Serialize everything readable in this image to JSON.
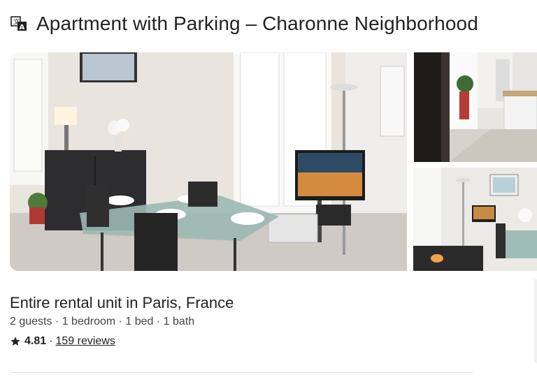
{
  "listing": {
    "title": "Apartment with Parking – Charonne Neighborhood",
    "subtitle": "Entire rental unit in Paris, France",
    "details": "2 guests · 1 bedroom · 1 bed · 1 bath",
    "rating": "4.81",
    "separator": "·",
    "reviews": "159 reviews"
  },
  "icons": {
    "translate": "translate-icon",
    "rating": "star-icon"
  },
  "photos": [
    {
      "name": "photo-dining-room"
    },
    {
      "name": "photo-kitchen-hallway"
    },
    {
      "name": "photo-dining-table"
    }
  ]
}
